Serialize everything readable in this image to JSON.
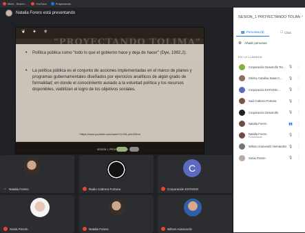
{
  "browser": {
    "tabs": [
      {
        "label": "Meet - Sesión...",
        "color": "#ea4335"
      },
      {
        "label": "YouTube",
        "color": "#ea4335"
      },
      {
        "label": "Proyectando",
        "color": "#1a73e8"
      }
    ]
  },
  "presenter": {
    "label": "Natalia Forero está presentando"
  },
  "slide": {
    "watermark": "\"PROYECTANDO TOLIMA\"",
    "bullets": [
      "Política pública como \"todo lo que el gobierno hace y deja de hacer\" (Dye, 1992,2).",
      "La política pública es el conjunto de acciones implementadas en el marco de planes y programas gubernamentales diseñados por ejercicios analíticos de algún grado de formalidad; en donde el conocimiento aunado a la voluntad política y los recursos disponibles, viabilizan el logro de los objetivos sociales."
    ],
    "link": "*https://www.youtube.com/watch?v=K6-pIrmZ5mo",
    "footer": "SESIÓN 1, PROYECTANDO"
  },
  "tiles": [
    {
      "name": "Natalia Forero",
      "muted": false
    },
    {
      "name": "Radio Cabrera Fortuna",
      "muted": true
    },
    {
      "name": "Corporación ESTADIO",
      "muted": true,
      "initial": "C"
    },
    {
      "name": "Sonia Pinzón",
      "muted": true
    },
    {
      "name": "Natalia Forero",
      "muted": true
    },
    {
      "name": "Wilson Aramendiz",
      "muted": true
    }
  ],
  "sidebar": {
    "title": "SESIÓN_1 PROYECTANDO TOLIMA",
    "tabs": [
      {
        "label": "Personas (9)"
      },
      {
        "label": "Chat"
      }
    ],
    "add_label": "Añadir personas",
    "section_label": "EN LA LLAMADA",
    "participants": [
      {
        "name": "Corporación Desarrollo Tol...",
        "sub": "",
        "color": "#7cb342"
      },
      {
        "name": "Shirley Catalina Salas C...",
        "sub": "",
        "color": "#8d6e63"
      },
      {
        "name": "Corporación ESTADIO...",
        "sub": "",
        "color": "#5c6bc0"
      },
      {
        "name": "Saúl Cabrera Fortuna",
        "sub": "",
        "color": "#795548"
      },
      {
        "name": "Corporación Desarrollo",
        "sub": "",
        "color": "#212121"
      },
      {
        "name": "Natalia Forero",
        "sub": "",
        "color": "#6d4c41"
      },
      {
        "name": "Natalia Forero",
        "sub": "Presentando",
        "color": "#6d4c41"
      },
      {
        "name": "Wilson Aramendiz Hernández",
        "sub": "",
        "color": "#757575"
      },
      {
        "name": "Sonia Pinzón",
        "sub": "",
        "color": "#bcaaa4"
      }
    ]
  }
}
